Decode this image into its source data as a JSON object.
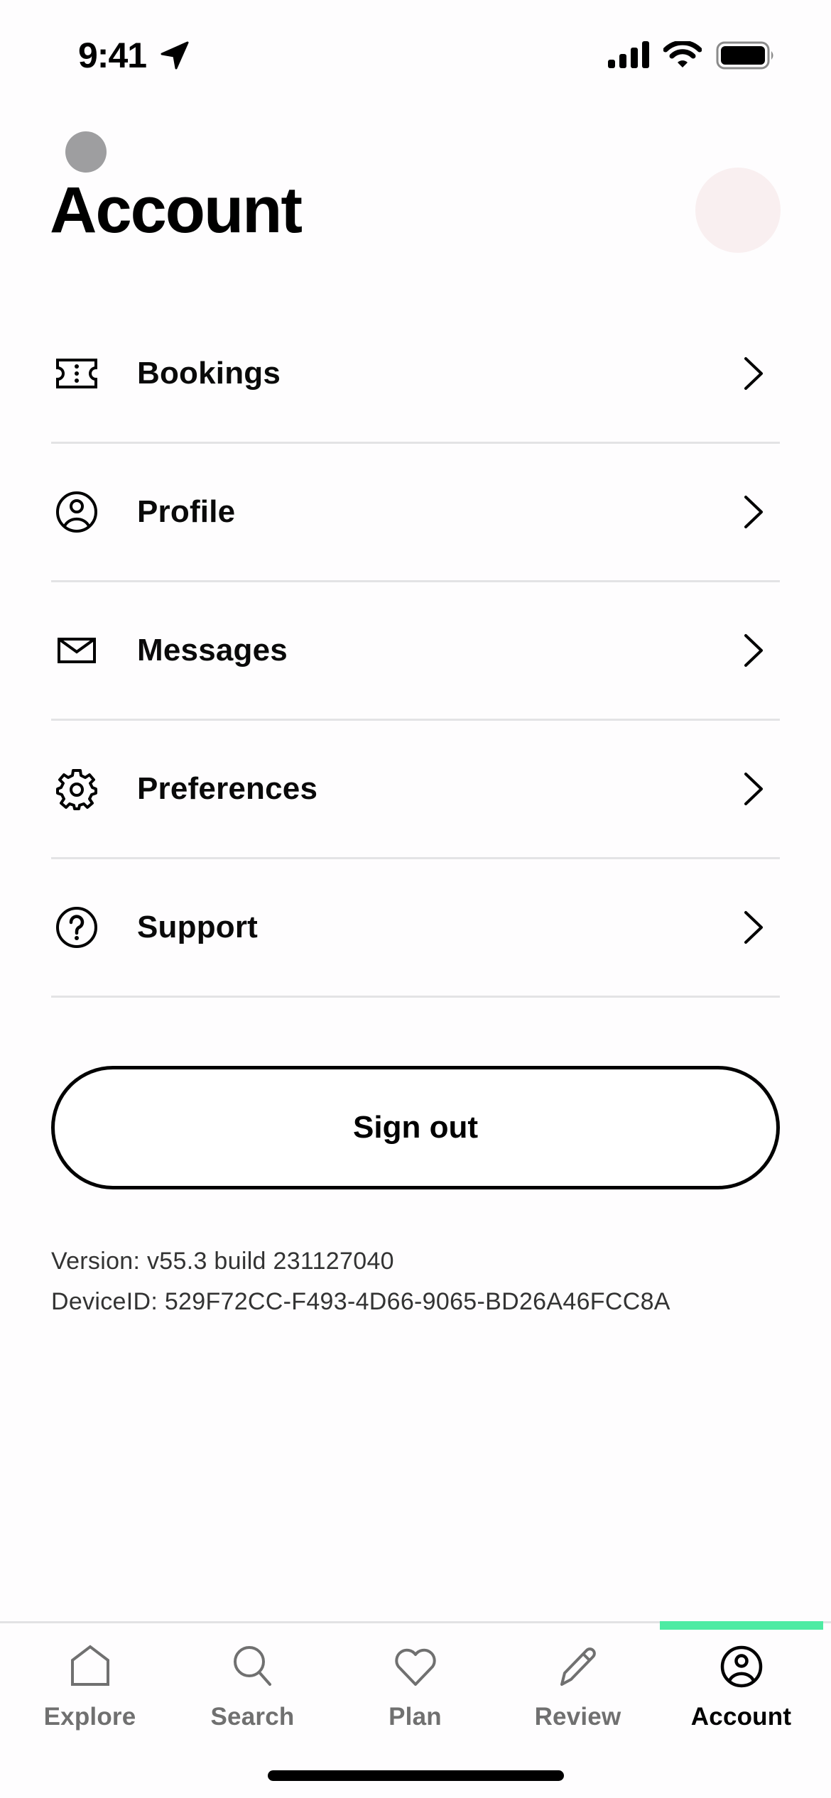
{
  "status_bar": {
    "time": "9:41",
    "icons": [
      "location-arrow-icon",
      "cellular-signal-icon",
      "wifi-icon",
      "battery-icon"
    ]
  },
  "header": {
    "title": "Account"
  },
  "menu": {
    "items": [
      {
        "label": "Bookings",
        "icon": "ticket-icon"
      },
      {
        "label": "Profile",
        "icon": "user-circle-icon"
      },
      {
        "label": "Messages",
        "icon": "envelope-icon"
      },
      {
        "label": "Preferences",
        "icon": "gear-icon"
      },
      {
        "label": "Support",
        "icon": "question-circle-icon"
      }
    ]
  },
  "signout": {
    "label": "Sign out"
  },
  "app_info": {
    "version": "Version: v55.3 build 231127040",
    "device_id": "DeviceID: 529F72CC-F493-4D66-9065-BD26A46FCC8A"
  },
  "tabbar": {
    "active": "Account",
    "accent_color": "#4EEBA3",
    "tabs": [
      {
        "label": "Explore",
        "icon": "home-icon"
      },
      {
        "label": "Search",
        "icon": "search-icon"
      },
      {
        "label": "Plan",
        "icon": "heart-icon"
      },
      {
        "label": "Review",
        "icon": "pencil-icon"
      },
      {
        "label": "Account",
        "icon": "user-circle-icon"
      }
    ]
  }
}
